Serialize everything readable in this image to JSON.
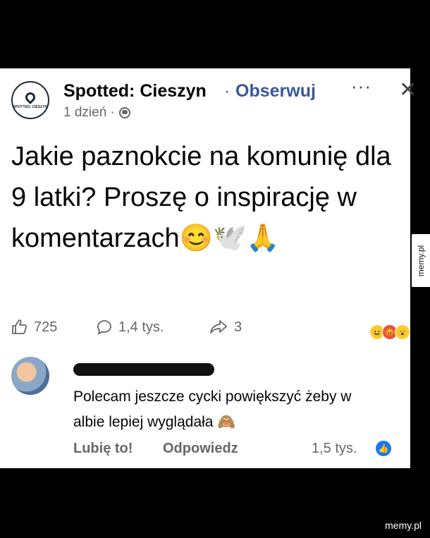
{
  "post": {
    "page_name": "Spotted: Cieszyn",
    "separator": "·",
    "follow_label": "Obserwuj",
    "time": "1 dzień ·",
    "more_label": "···",
    "close_label": "✕",
    "logo_text": "SPOTTED: CIESZYN",
    "text": "Jakie paznokcie na komunię dla 9 latki? Proszę o inspirację w komentarzach😊🕊️🙏",
    "likes": "725",
    "comments": "1,4 tys.",
    "shares": "3",
    "icons": {
      "like": "thumbs-up-icon",
      "comment": "speech-bubble-icon",
      "share": "share-arrow-icon",
      "globe": "globe-icon"
    }
  },
  "comment": {
    "text": "Polecam jeszcze cycki powiększyć żeby w albie lepiej wyglądała 🙈",
    "like_label": "Lubię to!",
    "reply_label": "Odpowiedz",
    "reaction_count": "1,5 tys."
  },
  "watermark": {
    "side": "memy.pl",
    "bottom": "memy.pl"
  }
}
